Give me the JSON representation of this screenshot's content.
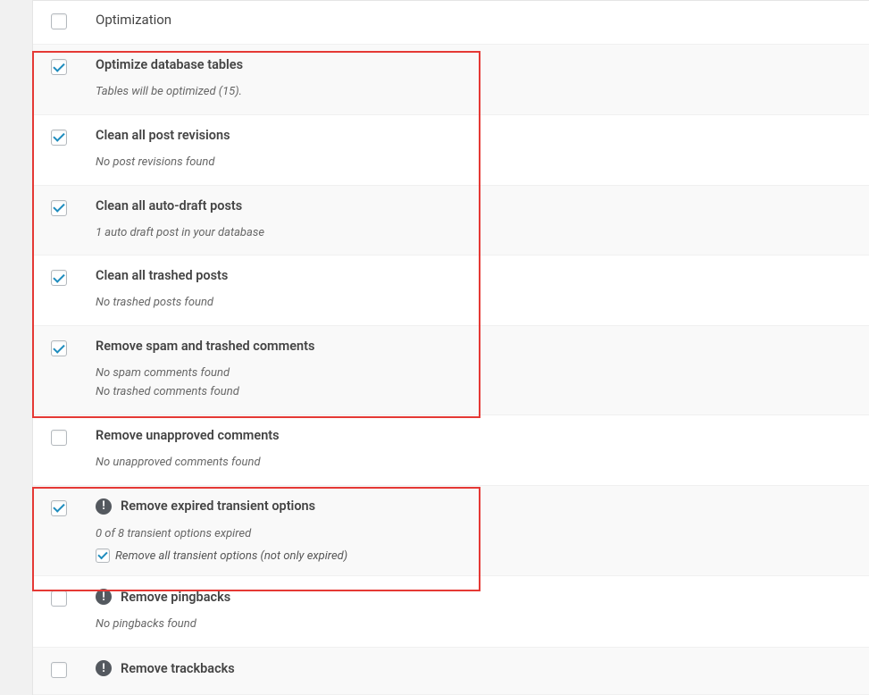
{
  "header": {
    "label": "Optimization"
  },
  "rows": [
    {
      "id": "optimize-db",
      "checked": true,
      "alt": true,
      "title": "Optimize database tables",
      "subtitles": [
        "Tables will be optimized (15)."
      ]
    },
    {
      "id": "clean-revisions",
      "checked": true,
      "alt": false,
      "title": "Clean all post revisions",
      "subtitles": [
        "No post revisions found"
      ]
    },
    {
      "id": "clean-autodraft",
      "checked": true,
      "alt": true,
      "title": "Clean all auto-draft posts",
      "subtitles": [
        "1 auto draft post in your database"
      ]
    },
    {
      "id": "clean-trashed",
      "checked": true,
      "alt": false,
      "title": "Clean all trashed posts",
      "subtitles": [
        "No trashed posts found"
      ]
    },
    {
      "id": "remove-spam",
      "checked": true,
      "alt": true,
      "title": "Remove spam and trashed comments",
      "subtitles": [
        "No spam comments found",
        "No trashed comments found"
      ]
    },
    {
      "id": "remove-unapproved",
      "checked": false,
      "alt": false,
      "title": "Remove unapproved comments",
      "subtitles": [
        "No unapproved comments found"
      ]
    },
    {
      "id": "remove-transient",
      "checked": true,
      "alt": true,
      "warn": true,
      "title": "Remove expired transient options",
      "subtitles": [
        "0 of 8 transient options expired"
      ],
      "subOption": {
        "checked": true,
        "label": "Remove all transient options (not only expired)"
      }
    },
    {
      "id": "remove-pingbacks",
      "checked": false,
      "alt": false,
      "warn": true,
      "title": "Remove pingbacks",
      "subtitles": [
        "No pingbacks found"
      ]
    },
    {
      "id": "remove-trackbacks",
      "checked": false,
      "alt": true,
      "warn": true,
      "title": "Remove trackbacks",
      "subtitles": []
    }
  ]
}
